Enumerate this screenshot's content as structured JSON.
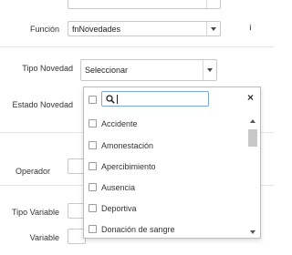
{
  "form": {
    "funcion": {
      "label": "Función",
      "value": "fnNovedades"
    },
    "info_icon": "i",
    "tipo_novedad": {
      "label": "Tipo Novedad",
      "value": "Seleccionar"
    },
    "estado_novedad": {
      "label": "Estado Novedad"
    },
    "operador": {
      "label": "Operador"
    },
    "tipo_variable": {
      "label": "Tipo Variable"
    },
    "variable": {
      "label": "Variable"
    }
  },
  "dropdown": {
    "search_value": "",
    "clear_label": "×",
    "options": [
      {
        "label": "Accidente",
        "checked": false
      },
      {
        "label": "Amonestación",
        "checked": false
      },
      {
        "label": "Apercibimiento",
        "checked": false
      },
      {
        "label": "Ausencia",
        "checked": false
      },
      {
        "label": "Deportiva",
        "checked": false
      },
      {
        "label": "Donación de sangre",
        "checked": false
      }
    ]
  },
  "colors": {
    "border": "#c8c8c8",
    "focus": "#7aa7d8",
    "text": "#333333"
  }
}
